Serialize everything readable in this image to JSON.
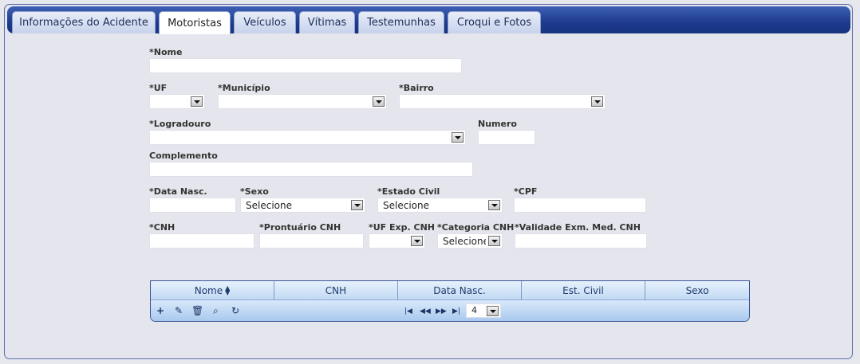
{
  "tabs": [
    "Informações do Acidente",
    "Motoristas",
    "Veículos",
    "Vítimas",
    "Testemunhas",
    "Croqui e Fotos"
  ],
  "active_tab": "Motoristas",
  "form": {
    "nome_label": "*Nome",
    "uf_label": "*UF",
    "municipio_label": "*Município",
    "bairro_label": "*Bairro",
    "logradouro_label": "*Logradouro",
    "numero_label": "Numero",
    "complemento_label": "Complemento",
    "data_nasc_label": "*Data Nasc.",
    "sexo_label": "*Sexo",
    "sexo_value": "Selecione",
    "estado_civil_label": "*Estado Civil",
    "estado_civil_value": "Selecione",
    "cpf_label": "*CPF",
    "cnh_label": "*CNH",
    "prontuario_label": "*Prontuário CNH",
    "uf_exp_label": "*UF Exp. CNH",
    "categoria_label": "*Categoria CNH",
    "categoria_value": "Selecione",
    "validade_label": "*Validade Exm. Med. CNH"
  },
  "grid": {
    "columns": [
      "Nome",
      "CNH",
      "Data Nasc.",
      "Est. Civil",
      "Sexo"
    ],
    "sort_column": "Nome",
    "page_size": "4",
    "icons": [
      "add-icon",
      "edit-icon",
      "delete-icon",
      "search-icon",
      "refresh-icon",
      "first-page-icon",
      "prev-page-icon",
      "next-page-icon",
      "last-page-icon"
    ]
  }
}
